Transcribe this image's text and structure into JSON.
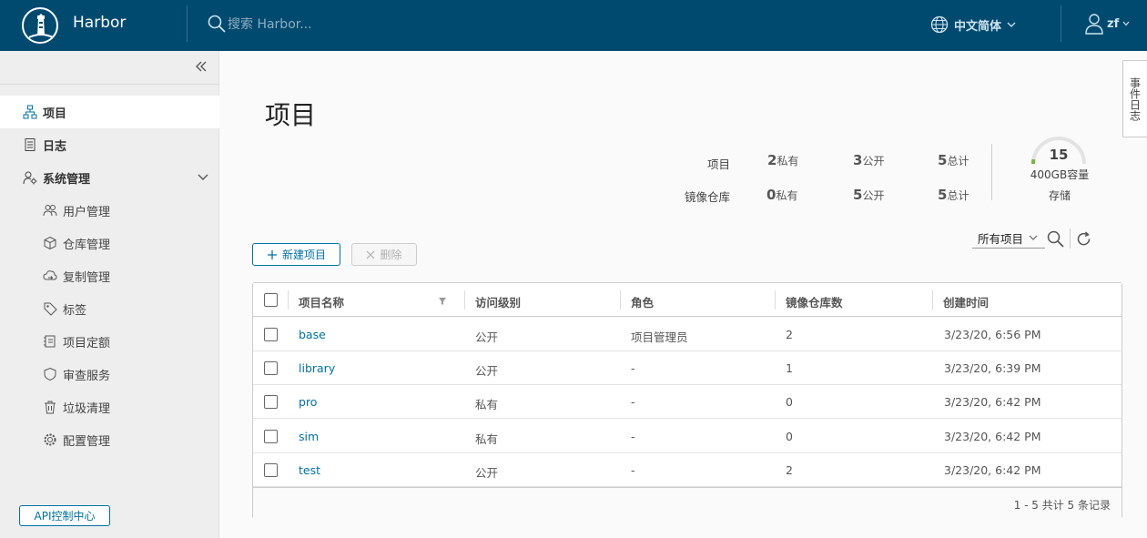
{
  "header": {
    "brand": "Harbor",
    "search_placeholder": "搜索 Harbor...",
    "language": "中文简体",
    "user": "zf"
  },
  "sidebar": {
    "items": [
      {
        "label": "项目",
        "icon": "projects-icon",
        "active": true
      },
      {
        "label": "日志",
        "icon": "logs-icon"
      },
      {
        "label": "系统管理",
        "icon": "admin-icon"
      }
    ],
    "sub_items": [
      {
        "label": "用户管理",
        "icon": "users-icon"
      },
      {
        "label": "仓库管理",
        "icon": "registry-icon"
      },
      {
        "label": "复制管理",
        "icon": "replication-icon"
      },
      {
        "label": "标签",
        "icon": "tag-icon"
      },
      {
        "label": "项目定额",
        "icon": "quota-icon"
      },
      {
        "label": "审查服务",
        "icon": "shield-icon"
      },
      {
        "label": "垃圾清理",
        "icon": "trash-icon"
      },
      {
        "label": "配置管理",
        "icon": "gear-icon"
      }
    ],
    "api_button": "API控制中心"
  },
  "main": {
    "title": "项目",
    "summary": {
      "projects_label": "项目",
      "repos_label": "镜像仓库",
      "projects": {
        "private": "2",
        "public": "3",
        "total": "5"
      },
      "repos": {
        "private": "0",
        "public": "5",
        "total": "5"
      },
      "private_suffix": "私有",
      "public_suffix": "公开",
      "total_suffix": "总计",
      "storage_value": "15",
      "storage_capacity": "400GB容量",
      "storage_label": "存储"
    },
    "toolbar": {
      "new_project": "新建项目",
      "delete": "删除",
      "filter": "所有项目"
    },
    "table": {
      "columns": [
        "项目名称",
        "访问级别",
        "角色",
        "镜像仓库数",
        "创建时间"
      ],
      "rows": [
        {
          "name": "base",
          "access": "公开",
          "role": "项目管理员",
          "repos": "2",
          "created": "3/23/20, 6:56 PM"
        },
        {
          "name": "library",
          "access": "公开",
          "role": "-",
          "repos": "1",
          "created": "3/23/20, 6:39 PM"
        },
        {
          "name": "pro",
          "access": "私有",
          "role": "-",
          "repos": "0",
          "created": "3/23/20, 6:42 PM"
        },
        {
          "name": "sim",
          "access": "私有",
          "role": "-",
          "repos": "0",
          "created": "3/23/20, 6:42 PM"
        },
        {
          "name": "test",
          "access": "公开",
          "role": "-",
          "repos": "2",
          "created": "3/23/20, 6:42 PM"
        }
      ],
      "footer": "1 - 5 共计 5 条记录"
    },
    "event_tab": "事件日志"
  },
  "colors": {
    "header_bg": "#004a70",
    "link": "#0072a3",
    "sidebar_bg": "#eeeeee"
  }
}
